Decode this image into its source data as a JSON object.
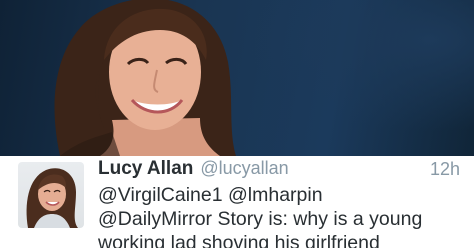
{
  "tweet": {
    "name": "Lucy Allan",
    "handle": "@lucyallan",
    "time": "12h",
    "lines": [
      "@VirgilCaine1 @lmharpin",
      "@DailyMirror Story is: why is a young",
      "working lad shoving his girlfriend"
    ]
  },
  "colors": {
    "photo_background": "#1a3552",
    "name_text": "#292f33",
    "secondary_text": "#8899a6"
  }
}
